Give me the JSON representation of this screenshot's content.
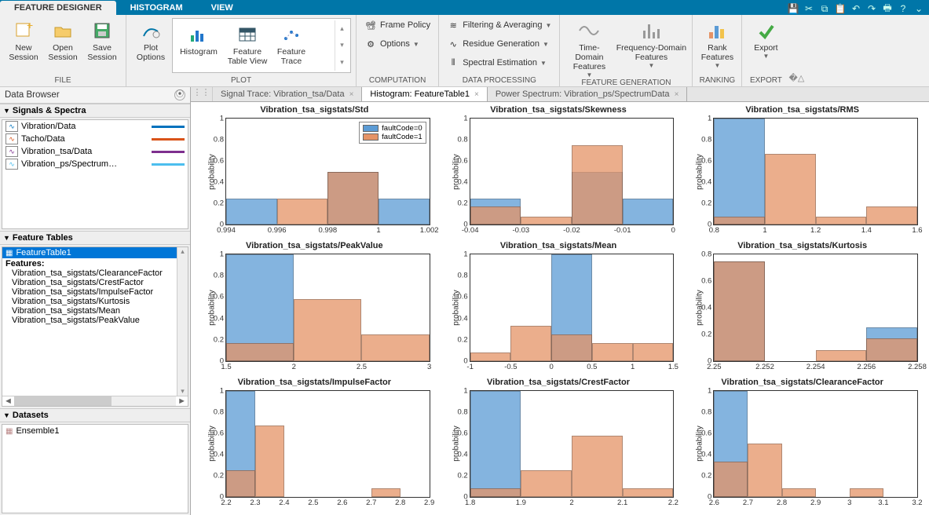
{
  "tabs": {
    "feature_designer": "FEATURE DESIGNER",
    "histogram": "HISTOGRAM",
    "view": "VIEW"
  },
  "ribbon": {
    "file": {
      "label": "FILE",
      "new_session": "New\nSession",
      "open_session": "Open\nSession",
      "save_session": "Save\nSession"
    },
    "plot": {
      "label": "PLOT",
      "plot_options": "Plot\nOptions",
      "histogram": "Histogram",
      "feature_table": "Feature\nTable View",
      "feature_trace": "Feature\nTrace"
    },
    "computation": {
      "label": "COMPUTATION",
      "frame_policy": "Frame Policy",
      "options": "Options"
    },
    "data_processing": {
      "label": "DATA PROCESSING",
      "filtering": "Filtering & Averaging",
      "residue": "Residue Generation",
      "spectral": "Spectral Estimation"
    },
    "feature_gen": {
      "label": "FEATURE GENERATION",
      "time": "Time-Domain\nFeatures",
      "freq": "Frequency-Domain\nFeatures"
    },
    "ranking": {
      "label": "RANKING",
      "rank": "Rank\nFeatures"
    },
    "export": {
      "label": "EXPORT",
      "export": "Export"
    }
  },
  "data_browser": {
    "title": "Data Browser"
  },
  "signals": {
    "title": "Signals & Spectra",
    "items": [
      {
        "label": "Vibration/Data",
        "color": "#0072bd"
      },
      {
        "label": "Tacho/Data",
        "color": "#d95319"
      },
      {
        "label": "Vibration_tsa/Data",
        "color": "#7e2f8e"
      },
      {
        "label": "Vibration_ps/Spectrum…",
        "color": "#4dbeee"
      }
    ]
  },
  "feature_tables": {
    "title": "Feature Tables",
    "selected": "FeatureTable1",
    "features_label": "Features:",
    "features": [
      "Vibration_tsa_sigstats/ClearanceFactor",
      "Vibration_tsa_sigstats/CrestFactor",
      "Vibration_tsa_sigstats/ImpulseFactor",
      "Vibration_tsa_sigstats/Kurtosis",
      "Vibration_tsa_sigstats/Mean",
      "Vibration_tsa_sigstats/PeakValue"
    ]
  },
  "datasets": {
    "title": "Datasets",
    "items": [
      "Ensemble1"
    ]
  },
  "doc_tabs": {
    "signal_trace": "Signal Trace: Vibration_tsa/Data",
    "histogram": "Histogram: FeatureTable1",
    "power": "Power Spectrum: Vibration_ps/SpectrumData"
  },
  "legend": {
    "f0": "faultCode=0",
    "f1": "faultCode=1"
  },
  "colors": {
    "c0": "#5b9bd5",
    "c1": "#e59366",
    "overlap": "#a87860"
  },
  "chart_data": [
    {
      "title": "Vibration_tsa_sigstats/Std",
      "ylabel": "probability",
      "ylim": [
        0,
        1
      ],
      "xticks": [
        0.994,
        0.996,
        0.998,
        1,
        1.002
      ],
      "bin_width": 0.002,
      "bin_start": 0.994,
      "series": [
        {
          "name": "faultCode=0",
          "values": [
            0.25,
            0,
            0.5,
            0.25
          ]
        },
        {
          "name": "faultCode=1",
          "values": [
            0,
            0.25,
            0.5,
            0
          ]
        }
      ],
      "show_legend": true
    },
    {
      "title": "Vibration_tsa_sigstats/Skewness",
      "ylabel": "probability",
      "ylim": [
        0,
        1
      ],
      "xticks": [
        -0.04,
        -0.03,
        -0.02,
        -0.01,
        0
      ],
      "bin_width": 0.01,
      "bin_start": -0.04,
      "series": [
        {
          "name": "faultCode=0",
          "values": [
            0.25,
            0,
            0.5,
            0.25
          ]
        },
        {
          "name": "faultCode=1",
          "values": [
            0.17,
            0.08,
            0.75,
            0
          ]
        }
      ]
    },
    {
      "title": "Vibration_tsa_sigstats/RMS",
      "ylabel": "probability",
      "ylim": [
        0,
        1
      ],
      "xticks": [
        0.8,
        1,
        1.2,
        1.4,
        1.6
      ],
      "bin_width": 0.2,
      "bin_start": 0.8,
      "series": [
        {
          "name": "faultCode=0",
          "values": [
            1.0,
            0,
            0,
            0
          ]
        },
        {
          "name": "faultCode=1",
          "values": [
            0.08,
            0.67,
            0.08,
            0.17
          ]
        }
      ]
    },
    {
      "title": "Vibration_tsa_sigstats/PeakValue",
      "ylabel": "probability",
      "ylim": [
        0,
        1
      ],
      "xticks": [
        1.5,
        2,
        2.5,
        3
      ],
      "bin_width": 0.5,
      "bin_start": 1.5,
      "series": [
        {
          "name": "faultCode=0",
          "values": [
            1.0,
            0,
            0
          ]
        },
        {
          "name": "faultCode=1",
          "values": [
            0.17,
            0.58,
            0.25
          ]
        }
      ]
    },
    {
      "title": "Vibration_tsa_sigstats/Mean",
      "ylabel": "probability",
      "ylim": [
        0,
        1
      ],
      "xticks": [
        -1,
        -0.5,
        0,
        0.5,
        1,
        1.5
      ],
      "bin_width": 0.5,
      "bin_start": -1,
      "series": [
        {
          "name": "faultCode=0",
          "values": [
            0,
            0,
            1.0,
            0,
            0
          ]
        },
        {
          "name": "faultCode=1",
          "values": [
            0.08,
            0.33,
            0.25,
            0.17,
            0.17
          ]
        }
      ]
    },
    {
      "title": "Vibration_tsa_sigstats/Kurtosis",
      "ylabel": "probability",
      "ylim": [
        0,
        0.8
      ],
      "xticks": [
        2.25,
        2.252,
        2.254,
        2.256,
        2.258
      ],
      "bin_width": 0.002,
      "bin_start": 2.25,
      "series": [
        {
          "name": "faultCode=0",
          "values": [
            0.75,
            0,
            0,
            0.25
          ]
        },
        {
          "name": "faultCode=1",
          "values": [
            0.75,
            0,
            0.08,
            0.17
          ]
        }
      ]
    },
    {
      "title": "Vibration_tsa_sigstats/ImpulseFactor",
      "ylabel": "probability",
      "ylim": [
        0,
        1
      ],
      "xticks": [
        2.2,
        2.3,
        2.4,
        2.5,
        2.6,
        2.7,
        2.8,
        2.9
      ],
      "bin_width": 0.1,
      "bin_start": 2.2,
      "series": [
        {
          "name": "faultCode=0",
          "values": [
            1.0,
            0,
            0,
            0,
            0,
            0,
            0
          ]
        },
        {
          "name": "faultCode=1",
          "values": [
            0.25,
            0.67,
            0,
            0,
            0,
            0.08,
            0
          ]
        }
      ]
    },
    {
      "title": "Vibration_tsa_sigstats/CrestFactor",
      "ylabel": "probability",
      "ylim": [
        0,
        1
      ],
      "xticks": [
        1.8,
        1.9,
        2,
        2.1,
        2.2
      ],
      "bin_width": 0.1,
      "bin_start": 1.8,
      "series": [
        {
          "name": "faultCode=0",
          "values": [
            1.0,
            0,
            0,
            0
          ]
        },
        {
          "name": "faultCode=1",
          "values": [
            0.08,
            0.25,
            0.58,
            0.08
          ]
        }
      ]
    },
    {
      "title": "Vibration_tsa_sigstats/ClearanceFactor",
      "ylabel": "probability",
      "ylim": [
        0,
        1
      ],
      "xticks": [
        2.6,
        2.7,
        2.8,
        2.9,
        3,
        3.1,
        3.2
      ],
      "bin_width": 0.1,
      "bin_start": 2.6,
      "series": [
        {
          "name": "faultCode=0",
          "values": [
            1.0,
            0,
            0,
            0,
            0,
            0
          ]
        },
        {
          "name": "faultCode=1",
          "values": [
            0.33,
            0.5,
            0.08,
            0,
            0.08,
            0
          ]
        }
      ]
    }
  ]
}
